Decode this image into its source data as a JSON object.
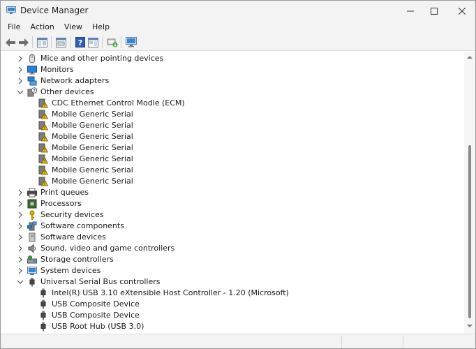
{
  "window": {
    "title": "Device Manager"
  },
  "menu": [
    "File",
    "Action",
    "View",
    "Help"
  ],
  "toolbar": [
    "back-arrow-icon",
    "forward-arrow-icon",
    "show-hide-console-tree-icon",
    "properties-icon",
    "help-icon",
    "action-pane-icon",
    "update-driver-icon",
    "scan-hardware-icon"
  ],
  "tree": [
    {
      "label": "Mice and other pointing devices",
      "level": 0,
      "expanded": false,
      "icon": "mouse-icon"
    },
    {
      "label": "Monitors",
      "level": 0,
      "expanded": false,
      "icon": "monitor-icon"
    },
    {
      "label": "Network adapters",
      "level": 0,
      "expanded": false,
      "icon": "network-adapter-icon"
    },
    {
      "label": "Other devices",
      "level": 0,
      "expanded": true,
      "icon": "unknown-device-icon"
    },
    {
      "label": "CDC Ethernet Control Modle (ECM)",
      "level": 1,
      "icon": "warning-device-icon"
    },
    {
      "label": "Mobile Generic Serial",
      "level": 1,
      "icon": "warning-device-icon"
    },
    {
      "label": "Mobile Generic Serial",
      "level": 1,
      "icon": "warning-device-icon"
    },
    {
      "label": "Mobile Generic Serial",
      "level": 1,
      "icon": "warning-device-icon"
    },
    {
      "label": "Mobile Generic Serial",
      "level": 1,
      "icon": "warning-device-icon"
    },
    {
      "label": "Mobile Generic Serial",
      "level": 1,
      "icon": "warning-device-icon"
    },
    {
      "label": "Mobile Generic Serial",
      "level": 1,
      "icon": "warning-device-icon"
    },
    {
      "label": "Mobile Generic Serial",
      "level": 1,
      "icon": "warning-device-icon"
    },
    {
      "label": "Print queues",
      "level": 0,
      "expanded": false,
      "icon": "printer-icon"
    },
    {
      "label": "Processors",
      "level": 0,
      "expanded": false,
      "icon": "processor-icon"
    },
    {
      "label": "Security devices",
      "level": 0,
      "expanded": false,
      "icon": "security-key-icon"
    },
    {
      "label": "Software components",
      "level": 0,
      "expanded": false,
      "icon": "software-component-icon"
    },
    {
      "label": "Software devices",
      "level": 0,
      "expanded": false,
      "icon": "software-device-icon"
    },
    {
      "label": "Sound, video and game controllers",
      "level": 0,
      "expanded": false,
      "icon": "speaker-icon"
    },
    {
      "label": "Storage controllers",
      "level": 0,
      "expanded": false,
      "icon": "storage-controller-icon"
    },
    {
      "label": "System devices",
      "level": 0,
      "expanded": false,
      "icon": "system-device-icon"
    },
    {
      "label": "Universal Serial Bus controllers",
      "level": 0,
      "expanded": true,
      "icon": "usb-icon"
    },
    {
      "label": "Intel(R) USB 3.10 eXtensible Host Controller - 1.20 (Microsoft)",
      "level": 1,
      "icon": "usb-device-icon"
    },
    {
      "label": "USB Composite Device",
      "level": 1,
      "icon": "usb-device-icon"
    },
    {
      "label": "USB Composite Device",
      "level": 1,
      "icon": "usb-device-icon"
    },
    {
      "label": "USB Root Hub (USB 3.0)",
      "level": 1,
      "icon": "usb-device-icon"
    }
  ],
  "colors": {
    "chrome": "#f3f3f3",
    "accent": "#2b6fb8",
    "warning": "#e8b400"
  }
}
